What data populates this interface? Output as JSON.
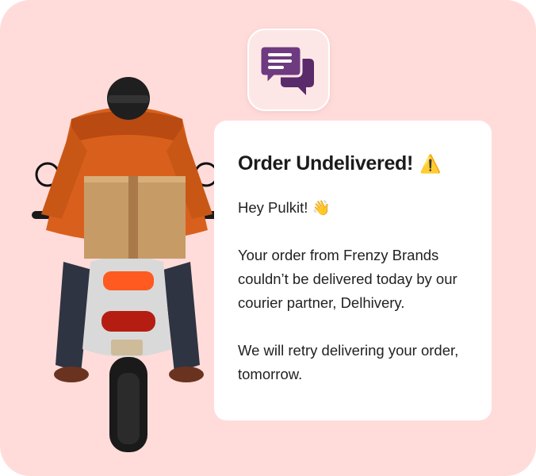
{
  "message": {
    "title": "Order Undelivered!",
    "title_emoji": "⚠️",
    "greeting": "Hey Pulkit!",
    "greeting_emoji": "👋",
    "paragraph1": "Your order from Frenzy Brands couldn’t be delivered today by our courier partner, Delhivery.",
    "paragraph2": "We will retry delivering your order, tomorrow."
  },
  "icons": {
    "chat": "chat-bubbles-icon",
    "warning": "warning-icon",
    "wave": "waving-hand-icon"
  },
  "colors": {
    "background": "#ffdcda",
    "icon_tile": "#fde7e6",
    "chat_icon": "#5a2a6a",
    "card": "#ffffff",
    "text": "#1b1b1b"
  }
}
